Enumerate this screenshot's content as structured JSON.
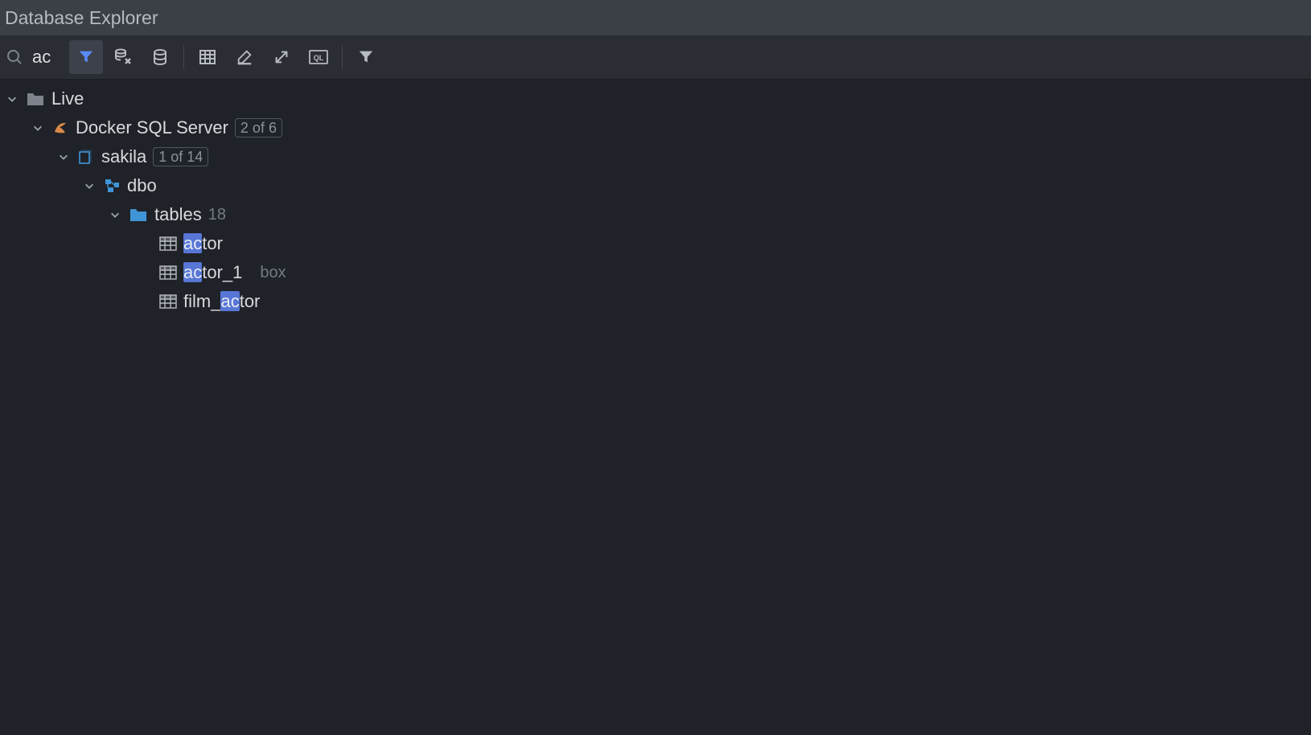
{
  "title": "Database Explorer",
  "search": {
    "value": "ac"
  },
  "tree": {
    "root": {
      "label": "Live"
    },
    "datasource": {
      "label": "Docker SQL Server",
      "badge": "2 of 6"
    },
    "database": {
      "label": "sakila",
      "badge": "1 of 14"
    },
    "schema": {
      "label": "dbo"
    },
    "tablesFolder": {
      "label": "tables",
      "count": "18"
    },
    "tables": [
      {
        "pre": "",
        "match": "ac",
        "post": "tor",
        "suffix": ""
      },
      {
        "pre": "",
        "match": "ac",
        "post": "tor_1",
        "suffix": "box"
      },
      {
        "pre": "film_",
        "match": "ac",
        "post": "tor",
        "suffix": ""
      }
    ]
  }
}
